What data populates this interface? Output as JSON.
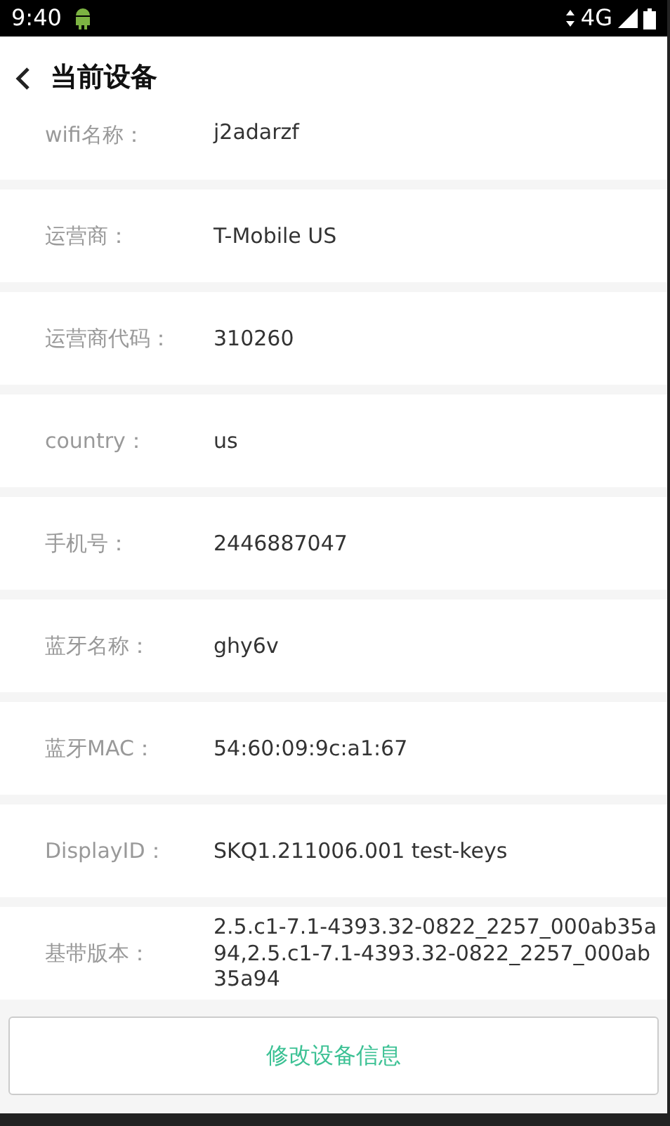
{
  "status_bar": {
    "time": "9:40",
    "network": "4G"
  },
  "header": {
    "title": "当前设备"
  },
  "fields": [
    {
      "label": "wifi名称：",
      "value": "j2adarzf"
    },
    {
      "label": "运营商：",
      "value": "T-Mobile US"
    },
    {
      "label": "运营商代码：",
      "value": "310260"
    },
    {
      "label": "country：",
      "value": "us"
    },
    {
      "label": "手机号：",
      "value": "2446887047"
    },
    {
      "label": "蓝牙名称：",
      "value": "ghy6v"
    },
    {
      "label": "蓝牙MAC：",
      "value": "54:60:09:9c:a1:67"
    },
    {
      "label": "DisplayID：",
      "value": "SKQ1.211006.001 test-keys"
    },
    {
      "label": "基带版本：",
      "value": "2.5.c1-7.1-4393.32-0822_2257_000ab35a94,2.5.c1-7.1-4393.32-0822_2257_000ab35a94"
    }
  ],
  "button": {
    "label": "修改设备信息"
  }
}
